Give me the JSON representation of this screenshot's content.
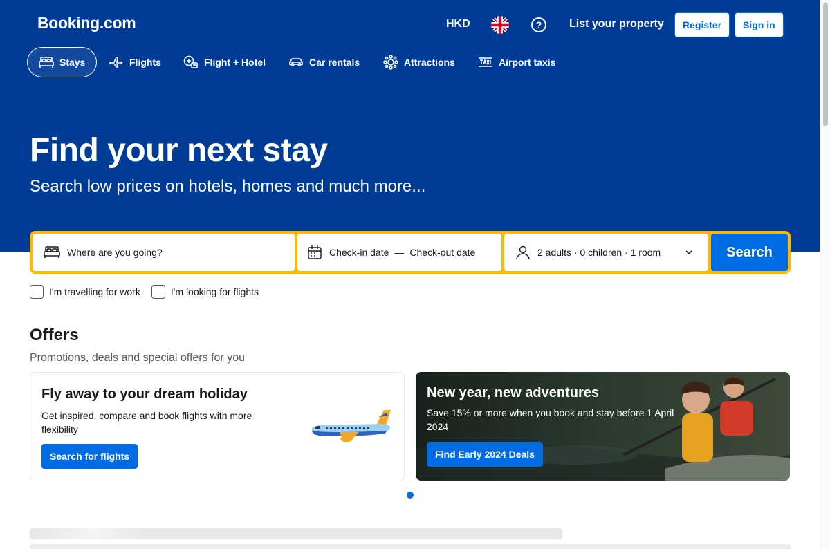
{
  "header": {
    "logo": "Booking.com",
    "currency": "HKD",
    "flag_icon": "uk-flag-icon",
    "help_icon": "question-circle-icon",
    "help_glyph": "?",
    "list_property": "List your property",
    "register": "Register",
    "sign_in": "Sign in"
  },
  "nav": {
    "items": [
      {
        "label": "Stays",
        "icon": "bed-icon",
        "active": true
      },
      {
        "label": "Flights",
        "icon": "plane-icon"
      },
      {
        "label": "Flight + Hotel",
        "icon": "flight-hotel-icon"
      },
      {
        "label": "Car rentals",
        "icon": "car-icon"
      },
      {
        "label": "Attractions",
        "icon": "attractions-icon"
      },
      {
        "label": "Airport taxis",
        "icon": "taxi-icon"
      }
    ]
  },
  "hero": {
    "title": "Find your next stay",
    "subtitle": "Search low prices on hotels, homes and much more..."
  },
  "search": {
    "destination_placeholder": "Where are you going?",
    "checkin": "Check-in date",
    "dash": "—",
    "checkout": "Check-out date",
    "guests": "2 adults · 0 children · 1 room",
    "button": "Search"
  },
  "checkboxes": {
    "work": "I'm travelling for work",
    "flights": "I'm looking for flights"
  },
  "offers": {
    "title": "Offers",
    "subtitle": "Promotions, deals and special offers for you",
    "cards": [
      {
        "title": "Fly away to your dream holiday",
        "text": "Get inspired, compare and book flights with more flexibility",
        "button": "Search for flights"
      },
      {
        "title": "New year, new adventures",
        "text": "Save 15% or more when you book and stay before 1 April 2024",
        "button": "Find Early 2024 Deals"
      }
    ]
  },
  "colors": {
    "brand_blue": "#003b95",
    "action_blue": "#006ce4",
    "search_border": "#ffb700"
  }
}
